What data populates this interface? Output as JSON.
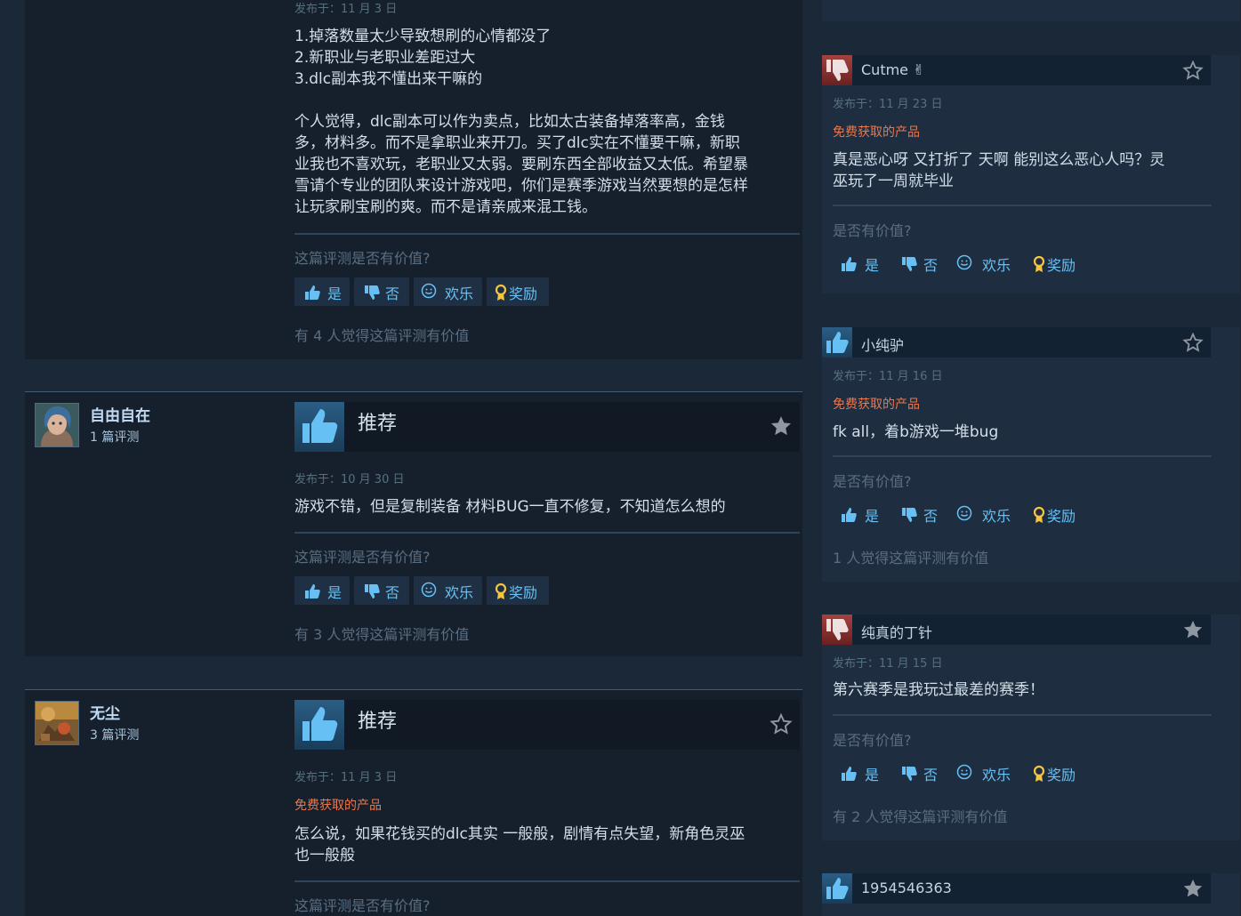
{
  "colors": {
    "page_bg": "#1b2838",
    "card_bg": "#16202d",
    "side_card_bg": "#1e2e40",
    "accent_link": "#66c0f4",
    "free_product": "#e9774b",
    "muted": "#5a6e81"
  },
  "icons": {
    "recommend": "thumbs-up-icon",
    "not_recommend": "thumbs-down-icon",
    "yes": "thumbs-up-icon",
    "no": "thumbs-down-icon",
    "funny": "smiley-icon",
    "award": "award-ribbon-icon",
    "bookmark": "star-icon"
  },
  "vote_labels": {
    "yes": "是",
    "no": "否",
    "funny": "欢乐",
    "award": "奖励"
  },
  "main_reviews": [
    {
      "date": "发布于：11 月 3 日",
      "content_lines": [
        "1.掉落数量太少导致想刷的心情都没了",
        "2.新职业与老职业差距过大",
        "3.dlc副本我不懂出来干嘛的",
        "",
        "个人觉得，dlc副本可以作为卖点，比如太古装备掉落率高，金钱",
        "多，材料多。而不是拿职业来开刀。买了dlc实在不懂要干嘛，新职",
        "业我也不喜欢玩，老职业又太弱。要刷东西全部收益又太低。希望暴",
        "雪请个专业的团队来设计游戏吧，你们是赛季游戏当然要想的是怎样",
        "让玩家刷宝刷的爽。而不是请亲戚来混工钱。"
      ],
      "helpful_question": "这篇评测是否有价值?",
      "found_helpful": "有 4 人觉得这篇评测有价值"
    },
    {
      "author_name": "自由自在",
      "author_reviews": "1 篇评测",
      "verdict": "推荐",
      "date": "发布于：10 月 30 日",
      "content_lines": [
        "游戏不错，但是复制装备 材料BUG一直不修复，不知道怎么想的"
      ],
      "helpful_question": "这篇评测是否有价值?",
      "found_helpful": "有 3 人觉得这篇评测有价值"
    },
    {
      "author_name": "无尘",
      "author_reviews": "3 篇评测",
      "verdict": "推荐",
      "date": "发布于：11 月 3 日",
      "free_label": "免费获取的产品",
      "content_lines": [
        "怎么说，如果花钱买的dlc其实 一般般，剧情有点失望，新角色灵巫",
        "也一般般"
      ],
      "helpful_question": "这篇评测是否有价值?"
    }
  ],
  "side_reviews": [
    {
      "name": "Cutme ✌",
      "verdict": "not_recommended",
      "date": "发布于：11 月 23 日",
      "free_label": "免费获取的产品",
      "content_lines": [
        "真是恶心呀 又打折了 天啊 能别这么恶心人吗？灵",
        "巫玩了一周就毕业"
      ],
      "helpful_question": "是否有价值?"
    },
    {
      "name": "小纯驴",
      "verdict": "recommended",
      "date": "发布于：11 月 16 日",
      "free_label": "免费获取的产品",
      "content_lines": [
        "fk all，着b游戏一堆bug"
      ],
      "helpful_question": "是否有价值?",
      "found_helpful": "1 人觉得这篇评测有价值"
    },
    {
      "name": "纯真的丁针",
      "verdict": "not_recommended",
      "date": "发布于：11 月 15 日",
      "content_lines": [
        "第六赛季是我玩过最差的赛季！"
      ],
      "helpful_question": "是否有价值?",
      "found_helpful": "有 2 人觉得这篇评测有价值"
    },
    {
      "name": "1954546363",
      "verdict": "recommended"
    }
  ]
}
